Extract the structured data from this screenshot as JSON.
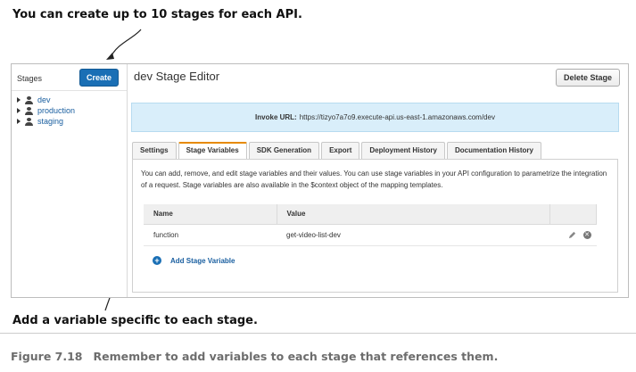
{
  "annotations": {
    "top": "You can create up to 10 stages for each API.",
    "bottom": "Add a variable specific to each stage."
  },
  "sidebar": {
    "title": "Stages",
    "create_label": "Create",
    "stages": [
      "dev",
      "production",
      "staging"
    ]
  },
  "header": {
    "title": "dev Stage Editor",
    "delete_label": "Delete Stage"
  },
  "invoke": {
    "label": "Invoke URL:",
    "url": "https://tizyo7a7o9.execute-api.us-east-1.amazonaws.com/dev"
  },
  "tabs": [
    "Settings",
    "Stage Variables",
    "SDK Generation",
    "Export",
    "Deployment History",
    "Documentation History"
  ],
  "active_tab": "Stage Variables",
  "panel": {
    "description": "You can add, remove, and edit stage variables and their values. You can use stage variables in your API configuration to parametrize the integration of a request. Stage variables are also available in the $context object of the mapping templates.",
    "columns": [
      "Name",
      "Value"
    ],
    "rows": [
      {
        "name": "function",
        "value": "get-video-list-dev"
      }
    ],
    "add_label": "Add Stage Variable"
  },
  "caption": {
    "number": "Figure 7.18",
    "text": "Remember to add variables to each stage that references them."
  },
  "colors": {
    "accent": "#1a6fb5",
    "invoke_bg": "#d9eefa",
    "active_tab_border": "#e68a00"
  }
}
